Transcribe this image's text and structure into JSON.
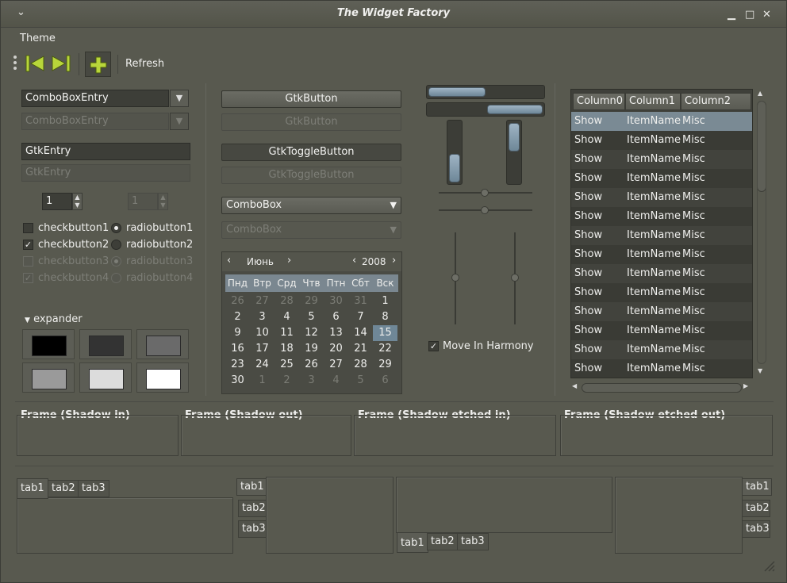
{
  "window": {
    "title": "The Widget Factory",
    "menu_glyph": "⌄",
    "min_glyph": "▁",
    "max_glyph": "□",
    "close_glyph": "✕"
  },
  "menu": {
    "theme": "Theme"
  },
  "toolbar": {
    "refresh_label": "Refresh"
  },
  "left": {
    "combo_entry": "ComboBoxEntry",
    "combo_entry_disabled": "ComboBoxEntry",
    "entry_value": "GtkEntry",
    "entry_disabled": "GtkEntry",
    "spin_value": "1",
    "spin_disabled_value": "1",
    "checks": [
      {
        "label": "checkbutton1",
        "checked": false,
        "disabled": false
      },
      {
        "label": "checkbutton2",
        "checked": true,
        "disabled": false
      },
      {
        "label": "checkbutton3",
        "checked": false,
        "disabled": true
      },
      {
        "label": "checkbutton4",
        "checked": true,
        "disabled": true
      }
    ],
    "radios": [
      {
        "label": "radiobutton1",
        "on": true,
        "disabled": false
      },
      {
        "label": "radiobutton2",
        "on": false,
        "disabled": false
      },
      {
        "label": "radiobutton3",
        "on": true,
        "disabled": true
      },
      {
        "label": "radiobutton4",
        "on": false,
        "disabled": true
      }
    ],
    "expander_label": "expander",
    "swatches": [
      "#000000",
      "#333333",
      "#6a6a6a",
      "#9a9a9a",
      "#dcdcdc",
      "#ffffff"
    ]
  },
  "middle": {
    "button": "GtkButton",
    "button_disabled": "GtkButton",
    "toggle": "GtkToggleButton",
    "toggle_disabled": "GtkToggleButton",
    "combo": "ComboBox",
    "combo_disabled": "ComboBox",
    "calendar": {
      "month": "Июнь",
      "year": "2008",
      "weekdays": [
        "Пнд",
        "Втр",
        "Срд",
        "Чтв",
        "Птн",
        "Сбт",
        "Вск"
      ],
      "selected": "15",
      "weeks": [
        [
          [
            "26",
            1
          ],
          [
            "27",
            1
          ],
          [
            "28",
            1
          ],
          [
            "29",
            1
          ],
          [
            "30",
            1
          ],
          [
            "31",
            1
          ],
          [
            "1",
            0
          ]
        ],
        [
          [
            "2",
            0
          ],
          [
            "3",
            0
          ],
          [
            "4",
            0
          ],
          [
            "5",
            0
          ],
          [
            "6",
            0
          ],
          [
            "7",
            0
          ],
          [
            "8",
            0
          ]
        ],
        [
          [
            "9",
            0
          ],
          [
            "10",
            0
          ],
          [
            "11",
            0
          ],
          [
            "12",
            0
          ],
          [
            "13",
            0
          ],
          [
            "14",
            0
          ],
          [
            "15",
            0
          ]
        ],
        [
          [
            "16",
            0
          ],
          [
            "17",
            0
          ],
          [
            "18",
            0
          ],
          [
            "19",
            0
          ],
          [
            "20",
            0
          ],
          [
            "21",
            0
          ],
          [
            "22",
            0
          ]
        ],
        [
          [
            "23",
            0
          ],
          [
            "24",
            0
          ],
          [
            "25",
            0
          ],
          [
            "26",
            0
          ],
          [
            "27",
            0
          ],
          [
            "28",
            0
          ],
          [
            "29",
            0
          ]
        ],
        [
          [
            "30",
            0
          ],
          [
            "1",
            1
          ],
          [
            "2",
            1
          ],
          [
            "3",
            1
          ],
          [
            "4",
            1
          ],
          [
            "5",
            1
          ],
          [
            "6",
            1
          ]
        ]
      ]
    }
  },
  "scales": {
    "harmony_label": "Move In Harmony",
    "harmony_checked": true
  },
  "tree": {
    "columns": [
      "Column0",
      "Column1",
      "Column2"
    ],
    "rows": [
      [
        "Show",
        "ItemName",
        "Misc"
      ],
      [
        "Show",
        "ItemName",
        "Misc"
      ],
      [
        "Show",
        "ItemName",
        "Misc"
      ],
      [
        "Show",
        "ItemName",
        "Misc"
      ],
      [
        "Show",
        "ItemName",
        "Misc"
      ],
      [
        "Show",
        "ItemName",
        "Misc"
      ],
      [
        "Show",
        "ItemName",
        "Misc"
      ],
      [
        "Show",
        "ItemName",
        "Misc"
      ],
      [
        "Show",
        "ItemName",
        "Misc"
      ],
      [
        "Show",
        "ItemName",
        "Misc"
      ],
      [
        "Show",
        "ItemName",
        "Misc"
      ],
      [
        "Show",
        "ItemName",
        "Misc"
      ],
      [
        "Show",
        "ItemName",
        "Misc"
      ],
      [
        "Show",
        "ItemName",
        "Misc"
      ]
    ]
  },
  "frames": [
    "Frame (Shadow in)",
    "Frame (Shadow out)",
    "Frame (Shadow etched in)",
    "Frame (Shadow etched out)"
  ],
  "tabs": [
    "tab1",
    "tab2",
    "tab3"
  ],
  "colors": {
    "accent": "#6f8797",
    "selection": "#7a8a94",
    "window_bg": "#58594f"
  }
}
